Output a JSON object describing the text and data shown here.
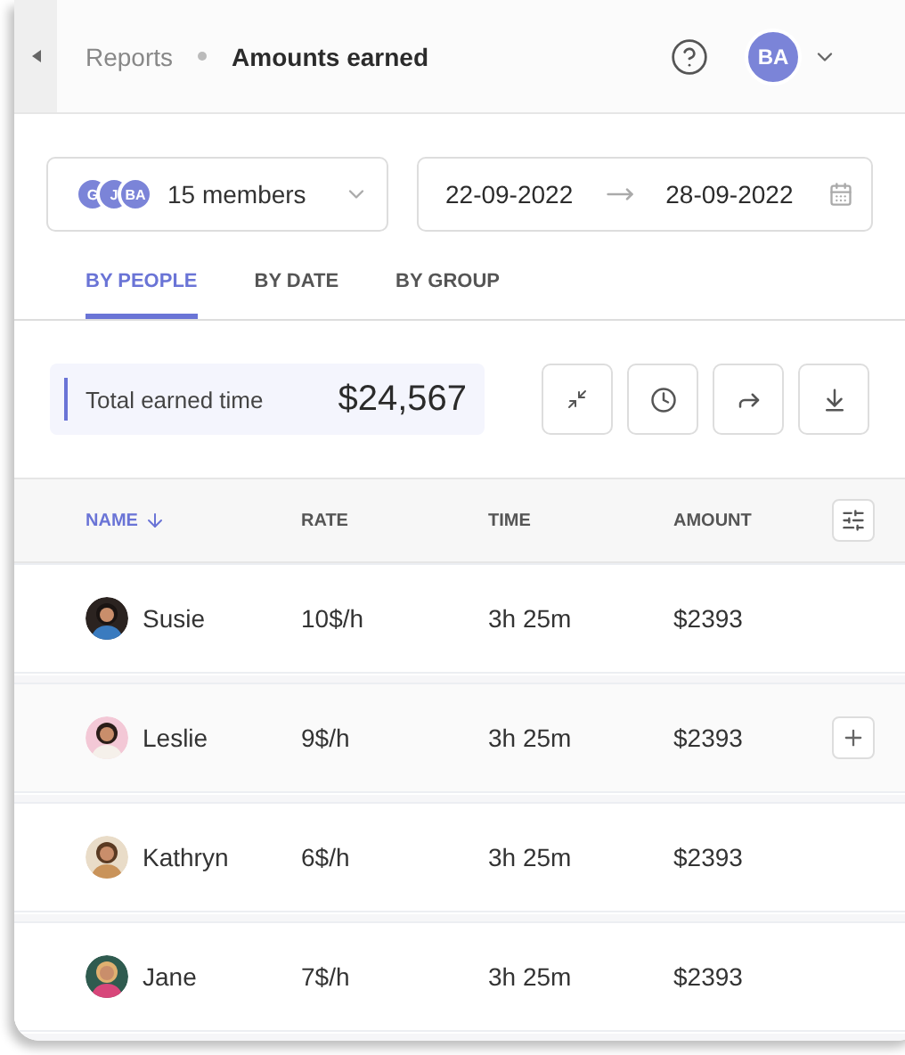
{
  "header": {
    "breadcrumb": [
      {
        "label": "Reports",
        "current": false
      },
      {
        "label": "Amounts earned",
        "current": true
      }
    ],
    "user_initials": "BA"
  },
  "filters": {
    "members": {
      "avatars": [
        "G",
        "J",
        "BA"
      ],
      "label": "15 members"
    },
    "date_from": "22-09-2022",
    "date_to": "28-09-2022"
  },
  "tabs": [
    {
      "label": "BY PEOPLE",
      "selected": true
    },
    {
      "label": "BY DATE",
      "selected": false
    },
    {
      "label": "BY GROUP",
      "selected": false
    }
  ],
  "summary": {
    "label": "Total earned time",
    "value": "$24,567"
  },
  "table": {
    "columns": [
      {
        "label": "NAME",
        "sorted": true
      },
      {
        "label": "RATE",
        "sorted": false
      },
      {
        "label": "TIME",
        "sorted": false
      },
      {
        "label": "AMOUNT",
        "sorted": false
      }
    ],
    "rows": [
      {
        "name": "Susie",
        "rate": "10$/h",
        "time": "3h 25m",
        "amount": "$2393",
        "hovered": false
      },
      {
        "name": "Leslie",
        "rate": "9$/h",
        "time": "3h 25m",
        "amount": "$2393",
        "hovered": true
      },
      {
        "name": "Kathryn",
        "rate": "6$/h",
        "time": "3h 25m",
        "amount": "$2393",
        "hovered": false
      },
      {
        "name": "Jane",
        "rate": "7$/h",
        "time": "3h 25m",
        "amount": "$2393",
        "hovered": false
      }
    ]
  }
}
